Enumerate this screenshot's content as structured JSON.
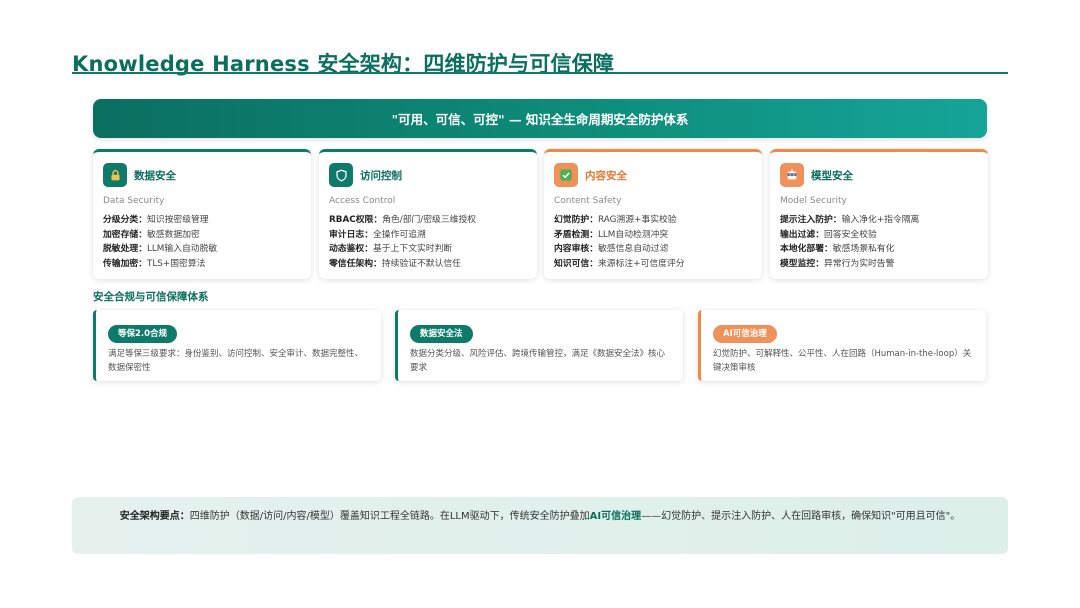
{
  "header": {
    "title": "Knowledge Harness 安全架构：四维防护与可信保障"
  },
  "banner": {
    "text": "\"可用、可信、可控\" — 知识全生命周期安全防护体系"
  },
  "cards": [
    {
      "icon": "lock-icon",
      "title": "数据安全",
      "subtitle": "Data Security",
      "lines": [
        {
          "key": "分级分类：",
          "value": "知识按密级管理"
        },
        {
          "key": "加密存储：",
          "value": "敏感数据加密"
        },
        {
          "key": "脱敏处理：",
          "value": "LLM输入自动脱敏"
        },
        {
          "key": "传输加密：",
          "value": "TLS+国密算法"
        }
      ]
    },
    {
      "icon": "shield-icon",
      "title": "访问控制",
      "subtitle": "Access Control",
      "lines": [
        {
          "key": "RBAC权限：",
          "value": "角色/部门/密级三维授权"
        },
        {
          "key": "审计日志：",
          "value": "全操作可追溯"
        },
        {
          "key": "动态鉴权：",
          "value": "基于上下文实时判断"
        },
        {
          "key": "零信任架构：",
          "value": "持续验证不默认信任"
        }
      ]
    },
    {
      "icon": "check-icon",
      "title": "内容安全",
      "subtitle": "Content Safety",
      "lines": [
        {
          "key": "幻觉防护：",
          "value": "RAG溯源+事实校验"
        },
        {
          "key": "矛盾检测：",
          "value": "LLM自动检测冲突"
        },
        {
          "key": "内容审核：",
          "value": "敏感信息自动过滤"
        },
        {
          "key": "知识可信：",
          "value": "来源标注+可信度评分"
        }
      ]
    },
    {
      "icon": "robot-icon",
      "title": "模型安全",
      "subtitle": "Model Security",
      "lines": [
        {
          "key": "提示注入防护：",
          "value": "输入净化+指令隔离"
        },
        {
          "key": "输出过滤：",
          "value": "回答安全校验"
        },
        {
          "key": "本地化部署：",
          "value": "敏感场景私有化"
        },
        {
          "key": "模型监控：",
          "value": "异常行为实时告警"
        }
      ]
    }
  ],
  "compliance": {
    "title": "安全合规与可信保障体系",
    "items": [
      {
        "tag": "等保2.0合规",
        "text": "满足等保三级要求：身份鉴别、访问控制、安全审计、数据完整性、数据保密性"
      },
      {
        "tag": "数据安全法",
        "text": "数据分类分级、风险评估、跨境传输管控，满足《数据安全法》核心要求"
      },
      {
        "tag": "AI可信治理",
        "text": "幻觉防护、可解释性、公平性、人在回路（Human-in-the-loop）关键决策审核"
      }
    ]
  },
  "summary": {
    "lead": "安全架构要点：",
    "before": "四维防护（数据/访问/内容/模型）覆盖知识工程全链路。在LLM驱动下，传统安全防护叠加",
    "highlight": "AI可信治理",
    "after": "——幻觉防护、提示注入防护、人在回路审核，确保知识\"可用且可信\"。"
  },
  "colors": {
    "teal": "#0d7a6a",
    "orange": "#ee8a46"
  }
}
